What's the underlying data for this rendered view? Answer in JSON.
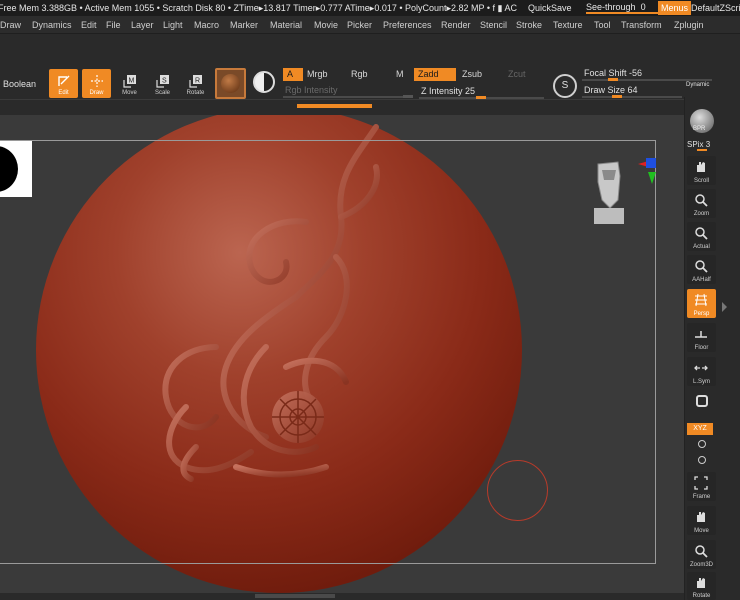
{
  "status_bar": {
    "stats": "Free Mem 3.388GB • Active Mem 1055 • Scratch Disk 80 • ZTime▸13.817 Timer▸0.777 ATime▸0.017 • PolyCount▸2.82 MP • f ▮ AC",
    "quicksave": "QuickSave",
    "see_through_label": "See-through",
    "see_through_value": "0",
    "menus": "Menus",
    "default_script": "DefaultZScript"
  },
  "menu_bar": [
    "Draw",
    "Dynamics",
    "Edit",
    "File",
    "Layer",
    "Light",
    "Macro",
    "Marker",
    "Material",
    "Movie",
    "Picker",
    "Preferences",
    "Render",
    "Stencil",
    "Stroke",
    "Texture",
    "Tool",
    "Transform",
    "Zplugin"
  ],
  "top_shelf": {
    "boolean": "Boolean",
    "tools": [
      {
        "label": "Edit",
        "active": true,
        "icon": "edit-icon"
      },
      {
        "label": "Draw",
        "active": true,
        "icon": "draw-icon"
      },
      {
        "label": "Move",
        "active": false,
        "icon": "move-icon"
      },
      {
        "label": "Scale",
        "active": false,
        "icon": "scale-icon"
      },
      {
        "label": "Rotate",
        "active": false,
        "icon": "rotate-icon"
      }
    ],
    "modes": {
      "a": "A",
      "mrgb": "Mrgb",
      "rgb": "Rgb",
      "m": "M",
      "zadd": "Zadd",
      "zsub": "Zsub",
      "zcut": "Zcut"
    },
    "rgb_intensity": "Rgb Intensity",
    "z_intensity_label": "Z Intensity",
    "z_intensity_value": "25",
    "focal_shift_label": "Focal Shift",
    "focal_shift_value": "-56",
    "draw_size_label": "Draw Size",
    "draw_size_value": "64",
    "dynamic": "Dynamic",
    "s_icon": "S"
  },
  "right_shelf": {
    "bpr": "BPR",
    "spix_label": "SPix",
    "spix_value": "3",
    "buttons": [
      {
        "label": "Scroll",
        "icon": "scroll-icon",
        "active": false
      },
      {
        "label": "Zoom",
        "icon": "zoom-icon",
        "active": false
      },
      {
        "label": "Actual",
        "icon": "actual-icon",
        "active": false
      },
      {
        "label": "AAHalf",
        "icon": "aahalf-icon",
        "active": false
      },
      {
        "label": "Persp",
        "icon": "persp-icon",
        "active": true
      },
      {
        "label": "Floor",
        "icon": "floor-icon",
        "active": false
      },
      {
        "label": "L.Sym",
        "icon": "lsym-icon",
        "active": false
      },
      {
        "label": "Frame",
        "icon": "frame-icon",
        "active": false
      },
      {
        "label": "Move",
        "icon": "move-icon",
        "active": false
      },
      {
        "label": "Zoom3D",
        "icon": "zoom3d-icon",
        "active": false
      },
      {
        "label": "Rotate",
        "icon": "rotate-icon",
        "active": false
      }
    ],
    "xyz": "XYZ"
  },
  "colors": {
    "accent": "#f08a24",
    "sphere": "#8a2a18",
    "canvas": "#3a3a3a"
  }
}
